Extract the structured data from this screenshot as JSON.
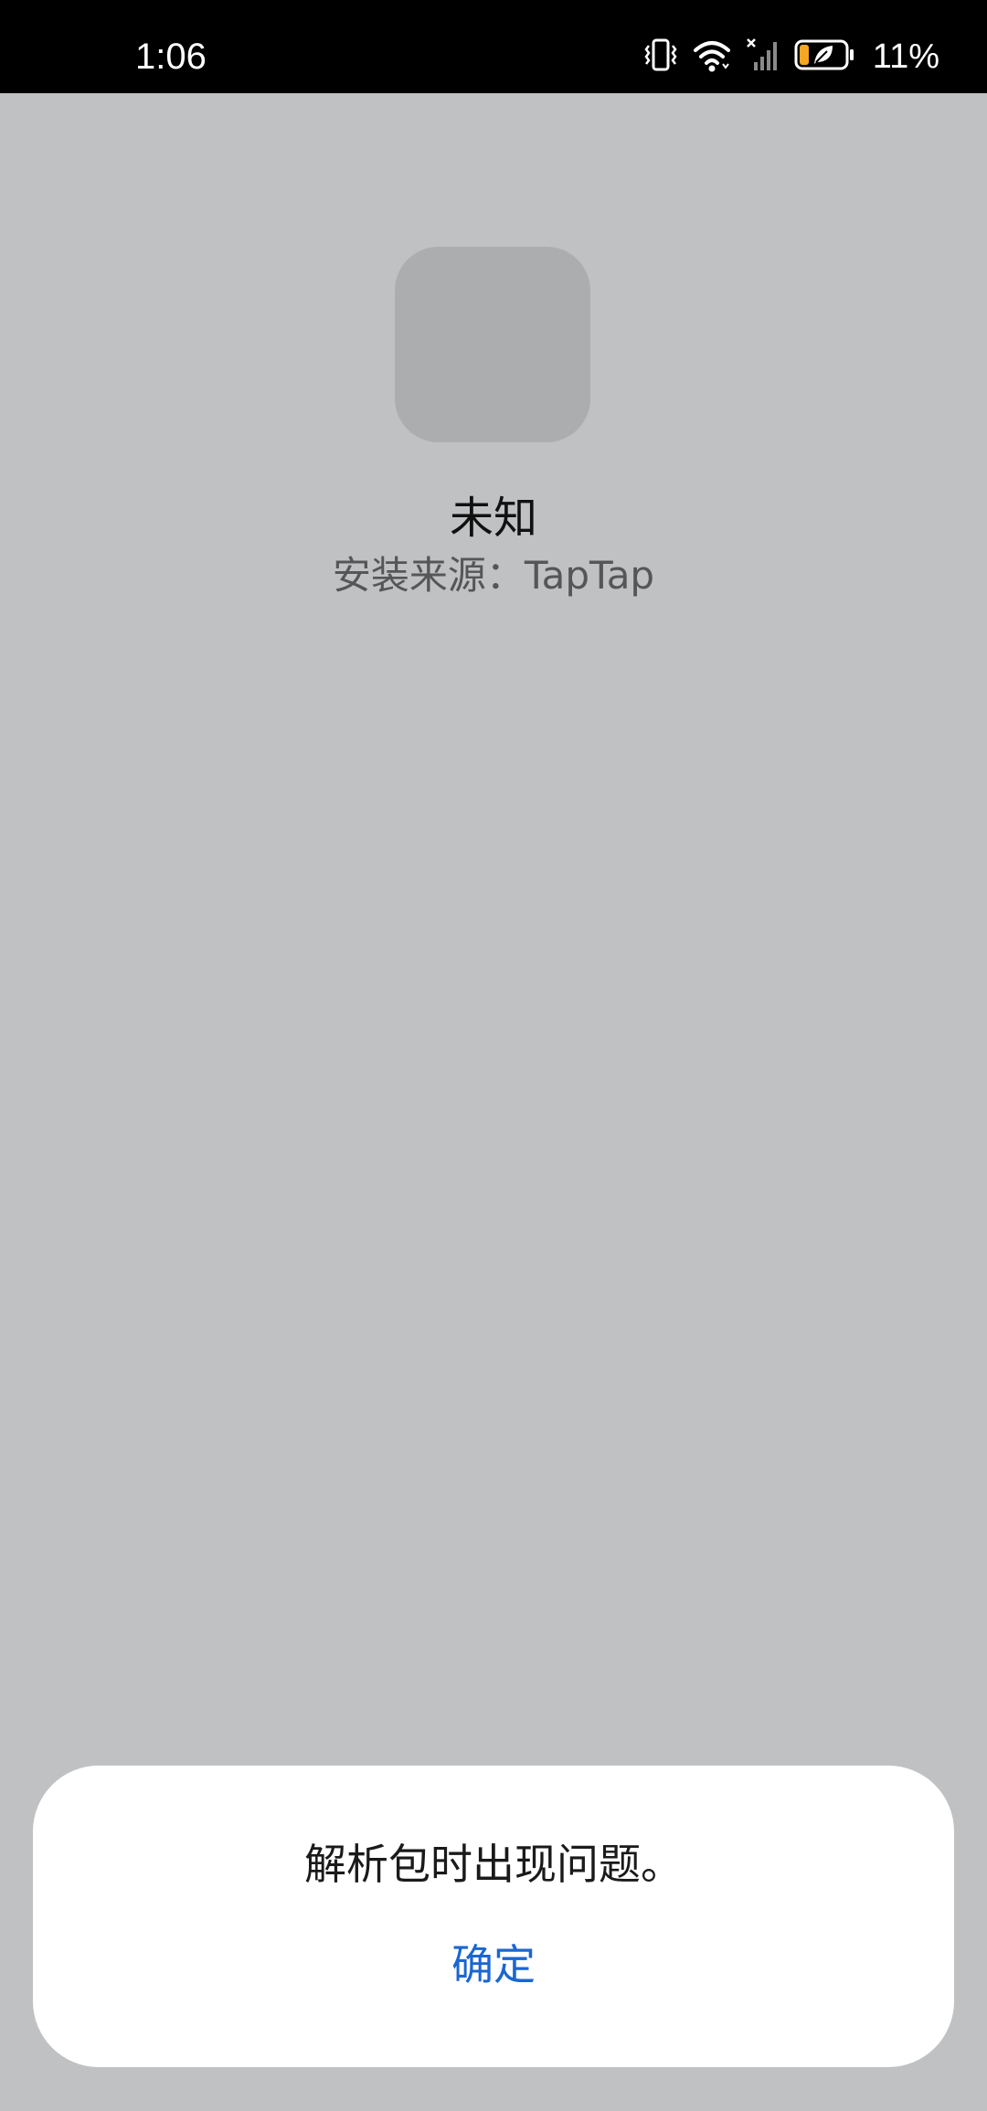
{
  "status_bar": {
    "time": "1:06",
    "battery_percent": "11%",
    "icons": [
      "vibrate-icon",
      "wifi-icon",
      "signal-no-service-icon",
      "battery-saver-icon"
    ],
    "battery_level": 0.11,
    "battery_fill_color": "#f5a623"
  },
  "app": {
    "name": "未知",
    "install_source": "安装来源：TapTap",
    "icon_placeholder_color": "#acadaf"
  },
  "dialog": {
    "message": "解析包时出现问题。",
    "confirm_label": "确定",
    "accent_color": "#1a66d2"
  },
  "colors": {
    "background": "#c0c1c3",
    "status_bar": "#000000",
    "dialog": "#ffffff"
  }
}
